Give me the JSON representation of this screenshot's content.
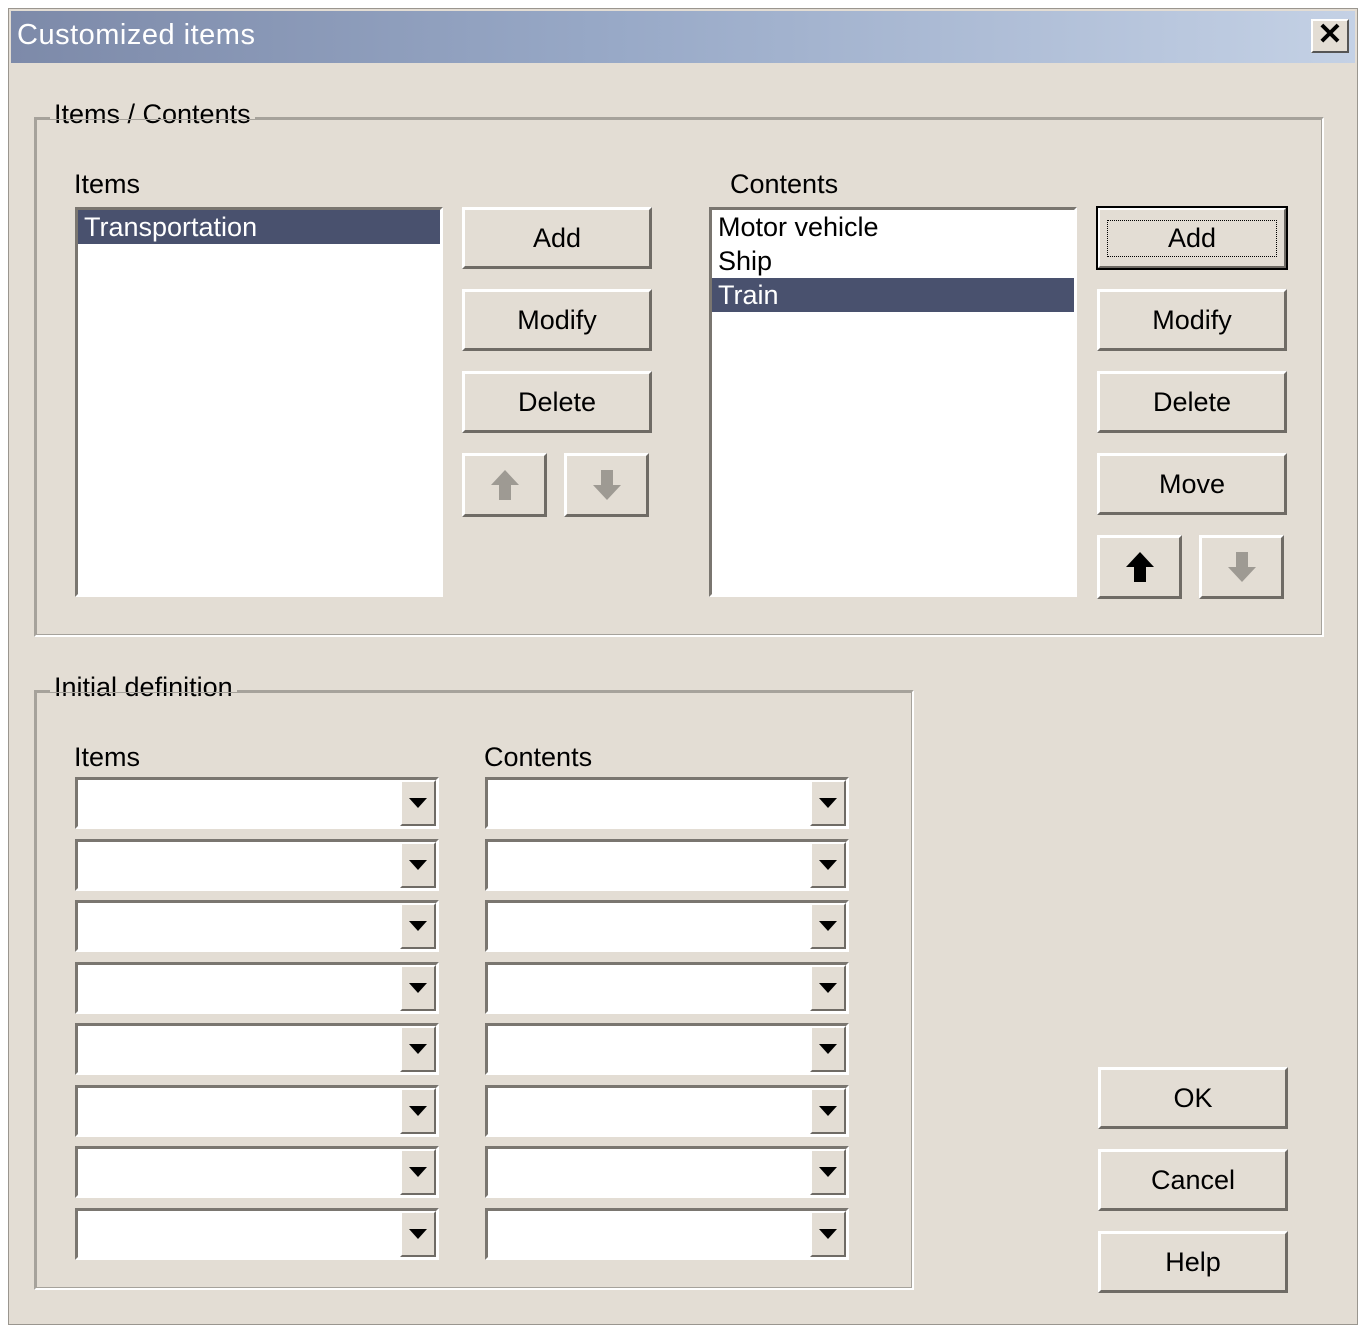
{
  "window": {
    "title": "Customized items",
    "close_label": "✕"
  },
  "items_contents": {
    "legend": "Items / Contents",
    "items_label": "Items",
    "contents_label": "Contents",
    "items_list": [
      {
        "label": "Transportation",
        "selected": true
      }
    ],
    "contents_list": [
      {
        "label": "Motor vehicle",
        "selected": false
      },
      {
        "label": "Ship",
        "selected": false
      },
      {
        "label": "Train",
        "selected": true
      }
    ],
    "item_buttons": {
      "add": "Add",
      "modify": "Modify",
      "delete": "Delete"
    },
    "content_buttons": {
      "add": "Add",
      "modify": "Modify",
      "delete": "Delete",
      "move": "Move"
    }
  },
  "initial_definition": {
    "legend": "Initial definition",
    "items_label": "Items",
    "contents_label": "Contents",
    "rows": [
      {
        "item": "",
        "content": ""
      },
      {
        "item": "",
        "content": ""
      },
      {
        "item": "",
        "content": ""
      },
      {
        "item": "",
        "content": ""
      },
      {
        "item": "",
        "content": ""
      },
      {
        "item": "",
        "content": ""
      },
      {
        "item": "",
        "content": ""
      },
      {
        "item": "",
        "content": ""
      }
    ]
  },
  "dialog_buttons": {
    "ok": "OK",
    "cancel": "Cancel",
    "help": "Help"
  },
  "colors": {
    "selection": "#49516e",
    "dialog_bg": "#e3ddd4",
    "title_gradient_start": "#7d8aa9",
    "title_gradient_end": "#c4d1e5",
    "disabled_arrow": "#9e9a93"
  },
  "icons": {
    "up": "arrow-up-icon",
    "down": "arrow-down-icon",
    "dropdown": "chevron-down-icon",
    "close": "close-icon"
  }
}
